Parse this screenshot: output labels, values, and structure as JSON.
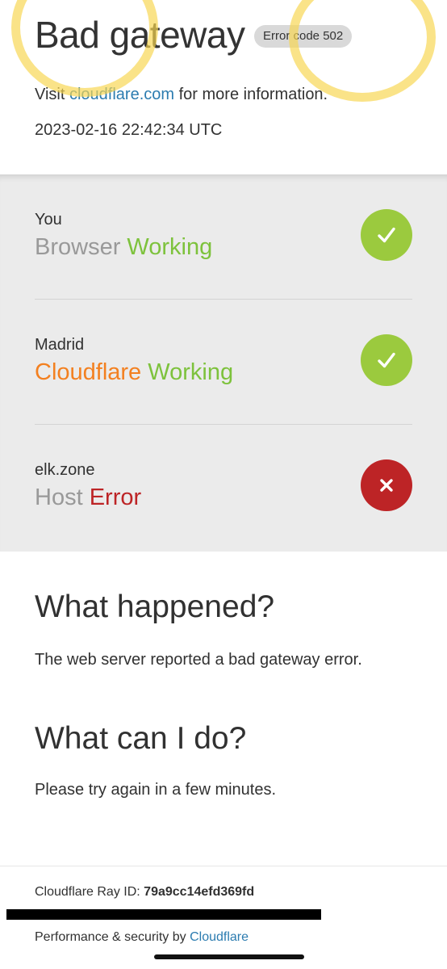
{
  "header": {
    "title": "Bad gateway",
    "error_badge": "Error code 502",
    "visit_prefix": "Visit ",
    "visit_link": "cloudflare.com",
    "visit_suffix": " for more information.",
    "timestamp": "2023-02-16 22:42:34 UTC"
  },
  "status": [
    {
      "location": "You",
      "type": "Browser",
      "status": "Working",
      "icon": "checkmark-icon",
      "state": "ok"
    },
    {
      "location": "Madrid",
      "type": "Cloudflare",
      "status": "Working",
      "icon": "checkmark-icon",
      "state": "ok"
    },
    {
      "location": "elk.zone",
      "type": "Host",
      "status": "Error",
      "icon": "x-icon",
      "state": "error"
    }
  ],
  "what_happened": {
    "heading": "What happened?",
    "text": "The web server reported a bad gateway error."
  },
  "what_can_i_do": {
    "heading": "What can I do?",
    "text": "Please try again in a few minutes."
  },
  "footer": {
    "ray_label": "Cloudflare Ray ID: ",
    "ray_id": "79a9cc14efd369fd",
    "perf_prefix": "Performance & security by ",
    "perf_link": "Cloudflare"
  },
  "colors": {
    "link": "#2c7cb0",
    "working": "#7dc23c",
    "error": "#bd2426",
    "cloudflare_orange": "#f38020",
    "ok_circle": "#9bca3e",
    "highlight": "#f7d650"
  }
}
